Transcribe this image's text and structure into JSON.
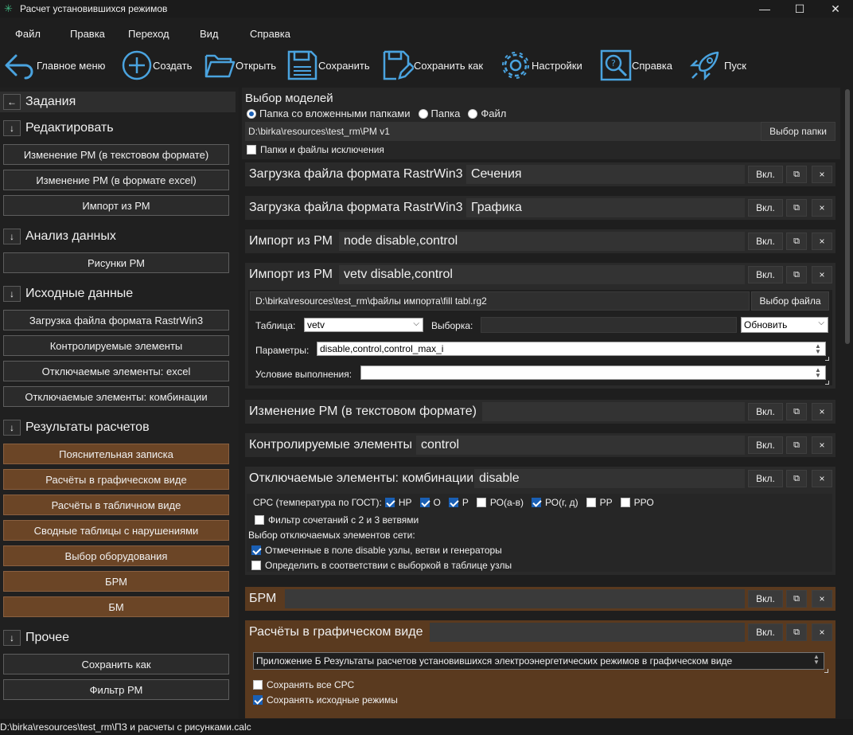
{
  "window": {
    "title": "Расчет установившихся режимов"
  },
  "menu": [
    "Файл",
    "Правка",
    "Переход",
    "Вид",
    "Справка"
  ],
  "toolbar": {
    "main_menu": "Главное меню",
    "create": "Создать",
    "open": "Открыть",
    "save": "Сохранить",
    "save_as": "Сохранить как",
    "settings": "Настройки",
    "help": "Справка",
    "run": "Пуск"
  },
  "sidebar": {
    "tasks_title": "Задания",
    "back_arrow": "←",
    "down_arrow": "↓",
    "sections": [
      {
        "title": "Редактировать",
        "items": [
          "Изменение РМ (в текстовом формате)",
          "Изменение РМ (в формате excel)",
          "Импорт из РМ"
        ]
      },
      {
        "title": "Анализ данных",
        "items": [
          "Рисунки РМ"
        ]
      },
      {
        "title": "Исходные данные",
        "items": [
          "Загрузка файла формата RastrWin3",
          "Контролируемые элементы",
          "Отключаемые элементы: excel",
          "Отключаемые элементы: комбинации"
        ]
      },
      {
        "title": "Результаты расчетов",
        "items": [
          "Пояснительная записка",
          "Расчёты в графическом виде",
          "Расчёты в табличном виде",
          "Сводные таблицы с нарушениями",
          "Выбор оборудования",
          "БРМ",
          "БМ"
        ]
      },
      {
        "title": "Прочее",
        "items": [
          "Сохранить как",
          "Фильтр РМ"
        ]
      }
    ]
  },
  "models": {
    "title": "Выбор моделей",
    "radio": [
      "Папка со вложенными папками",
      "Папка",
      "Файл"
    ],
    "selected_radio": "Папка со вложенными папками",
    "path": "D:\\birka\\resources\\test_rm\\РМ v1",
    "folder_button": "Выбор папки",
    "exclusions_label": "Папки и файлы исключения"
  },
  "buttons": {
    "enable": "Вкл.",
    "copy": "⧉",
    "close": "×"
  },
  "tasks": {
    "t1": {
      "name": "Загрузка файла формата RastrWin3",
      "value": "Сечения"
    },
    "t2": {
      "name": "Загрузка файла формата RastrWin3",
      "value": "Графика"
    },
    "t3": {
      "name": "Импорт из РМ",
      "value": "node disable,control"
    },
    "t4": {
      "name": "Импорт из РМ",
      "value": "vetv disable,control",
      "file_path": "D:\\birka\\resources\\test_rm\\файлы импорта\\fill tabl.rg2",
      "file_button": "Выбор файла",
      "table_label": "Таблица:",
      "table_value": "vetv",
      "selection_label": "Выборка:",
      "mode_value": "Обновить",
      "params_label": "Параметры:",
      "params_value": "disable,control,control_max_i",
      "condition_label": "Условие выполнения:"
    },
    "t5": {
      "name": "Изменение РМ (в текстовом формате)",
      "value": ""
    },
    "t6": {
      "name": "Контролируемые элементы",
      "value": "control"
    },
    "t7": {
      "name": "Отключаемые элементы: комбинации",
      "value": "disable",
      "crc_label": "СРС (температура по ГОСТ):",
      "crc_options": [
        {
          "label": "НР",
          "checked": true
        },
        {
          "label": "О",
          "checked": true
        },
        {
          "label": "Р",
          "checked": true
        },
        {
          "label": "РО(а-в)",
          "checked": false
        },
        {
          "label": "РО(г, д)",
          "checked": true
        },
        {
          "label": "РР",
          "checked": false
        },
        {
          "label": "РРО",
          "checked": false
        }
      ],
      "filter_label": "Фильтр сочетаний с 2 и 3 ветвями",
      "choose_label": "Выбор отключаемых элементов сети:",
      "option_marked": "Отмеченные в поле disable узлы, ветви и генераторы",
      "option_by_selection": "Определить в соответствии с выборкой в таблице узлы"
    },
    "t8": {
      "name": "БРМ",
      "value": ""
    },
    "t9": {
      "name": "Расчёты в графическом виде",
      "value": "",
      "caption_value": "Приложение Б Результаты расчетов установившихся электроэнергетических режимов в графическом виде",
      "save_all_crc": "Сохранять все СРС",
      "save_initial": "Сохранять исходные режимы"
    }
  },
  "status": {
    "path": "D:\\birka\\resources\\test_rm\\ПЗ и расчеты с рисунками.calc"
  },
  "colors": {
    "accent": "#1a5fb4",
    "brown": "#6b4526",
    "panel": "#2a2a2a",
    "background": "#1e1e1e"
  }
}
